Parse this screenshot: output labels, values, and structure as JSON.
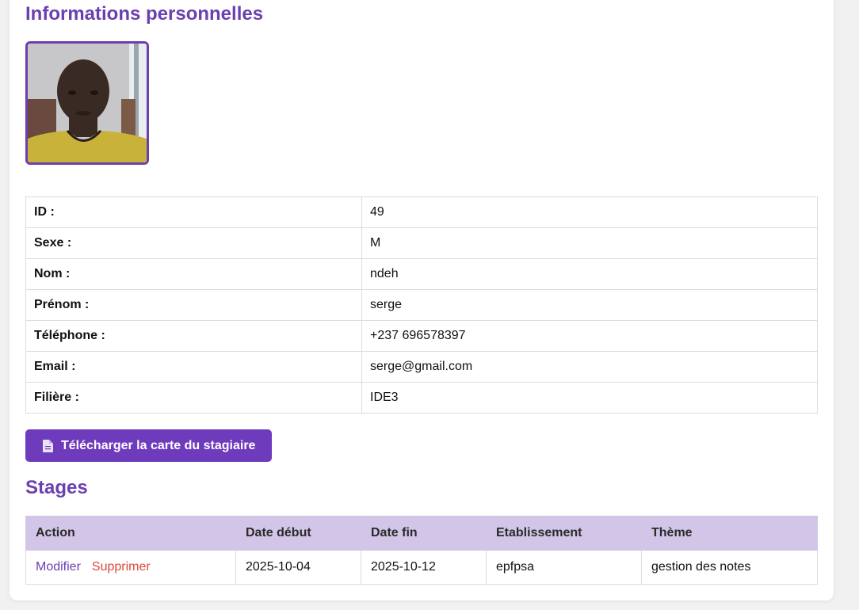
{
  "info": {
    "title": "Informations personnelles",
    "photo_alt": "Photo du stagiaire",
    "rows": [
      {
        "label": "ID :",
        "value": "49"
      },
      {
        "label": "Sexe :",
        "value": "M"
      },
      {
        "label": "Nom :",
        "value": "ndeh"
      },
      {
        "label": "Prénom :",
        "value": "serge"
      },
      {
        "label": "Téléphone :",
        "value": "+237 696578397"
      },
      {
        "label": "Email :",
        "value": "serge@gmail.com"
      },
      {
        "label": "Filière :",
        "value": "IDE3"
      }
    ],
    "download_label": "Télécharger la carte du stagiaire",
    "download_icon": "document-icon"
  },
  "stages": {
    "title": "Stages",
    "headers": [
      "Action",
      "Date début",
      "Date fin",
      "Etablissement",
      "Thème"
    ],
    "rows": [
      {
        "edit_label": "Modifier",
        "delete_label": "Supprimer",
        "date_debut": "2025-10-04",
        "date_fin": "2025-10-12",
        "etablissement": "epfpsa",
        "theme": "gestion des notes"
      }
    ]
  },
  "colors": {
    "accent": "#6b3fb0",
    "button": "#6f3bbd",
    "table_header": "#d2c5e8",
    "danger": "#d9483b"
  }
}
